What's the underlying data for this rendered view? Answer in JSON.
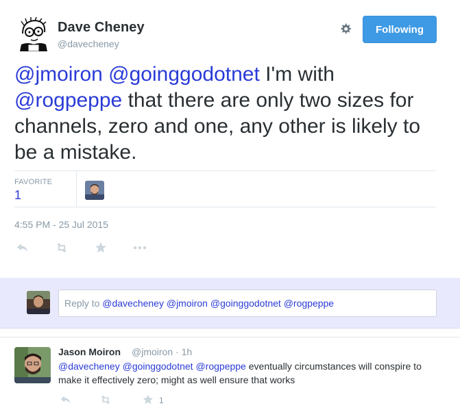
{
  "author": {
    "name": "Dave Cheney",
    "handle": "@davecheney"
  },
  "header": {
    "follow_label": "Following",
    "settings_icon": "gear-icon"
  },
  "tweet": {
    "mention1": "@jmoiron",
    "mention2": "@goinggodotnet",
    "text1": " I'm with ",
    "mention3": "@rogpeppe",
    "text2": " that there are only two sizes for channels, zero and one, any other is likely to be a mistake."
  },
  "stats": {
    "favorite_label": "FAVORITE",
    "favorite_count": "1"
  },
  "timestamp": "4:55 PM - 25 Jul 2015",
  "actions": [
    "reply-icon",
    "retweet-icon",
    "favorite-star-icon",
    "more-icon"
  ],
  "reply_box": {
    "prefix": "Reply to ",
    "mentions": "@davecheney @jmoiron @goinggodotnet @rogpeppe"
  },
  "reply_tweet": {
    "name": "Jason Moiron",
    "handle": "@jmoiron",
    "separator": " · ",
    "time": "1h",
    "mention1": "@davecheney",
    "mention2": "@goinggodotnet",
    "mention3": "@rogpeppe",
    "text": " eventually circumstances will conspire to make it effectively zero; might as well ensure that works",
    "favorite_count": "1"
  },
  "colors": {
    "link": "#2a3bd6",
    "button": "#3e9ae4",
    "reply_band": "#e8e9fc",
    "muted": "#8899a6"
  }
}
